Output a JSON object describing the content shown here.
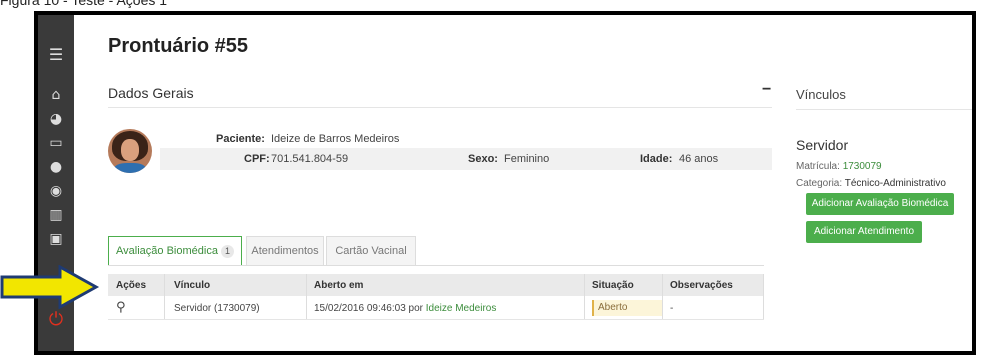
{
  "caption": "Figura 10 - Teste - Ações 1",
  "page_title": "Prontuário #55",
  "general": {
    "title": "Dados Gerais",
    "collapse_symbol": "−",
    "patient_label": "Paciente:",
    "patient_value": "Ideize de Barros Medeiros",
    "cpf_label": "CPF:",
    "cpf_value": "701.541.804-59",
    "sex_label": "Sexo:",
    "sex_value": "Feminino",
    "age_label": "Idade:",
    "age_value": "46 anos"
  },
  "right_panel": {
    "title": "Vínculos",
    "type": "Servidor",
    "matricula_label": "Matrícula:",
    "matricula_value": "1730079",
    "categoria_label": "Categoria:",
    "categoria_value": "Técnico-Administrativo",
    "btn_biomedica": "Adicionar Avaliação Biomédica",
    "btn_atendimento": "Adicionar Atendimento"
  },
  "tabs": [
    {
      "label": "Avaliação Biomédica",
      "badge": "1"
    },
    {
      "label": "Atendimentos"
    },
    {
      "label": "Cartão Vacinal"
    }
  ],
  "table": {
    "headers": [
      "Ações",
      "Vínculo",
      "Aberto em",
      "Situação",
      "Observações"
    ],
    "rows": [
      {
        "vinculo": "Servidor (1730079)",
        "aberto_em": "15/02/2016 09:46:03 por",
        "aberto_por": "Ideize Medeiros",
        "situacao": "Aberto",
        "observacoes": "-"
      }
    ]
  },
  "colors": {
    "accent": "#4cae4c",
    "sidebar": "#3a3a3a",
    "power": "#e0301e",
    "arrow": "#f2e600"
  },
  "sidebar_icons": [
    "menu-icon",
    "home-icon",
    "pie-chart-icon",
    "monitor-icon",
    "user-icon",
    "compass-icon",
    "bar-chart-icon",
    "briefcase-icon",
    "power-icon"
  ]
}
